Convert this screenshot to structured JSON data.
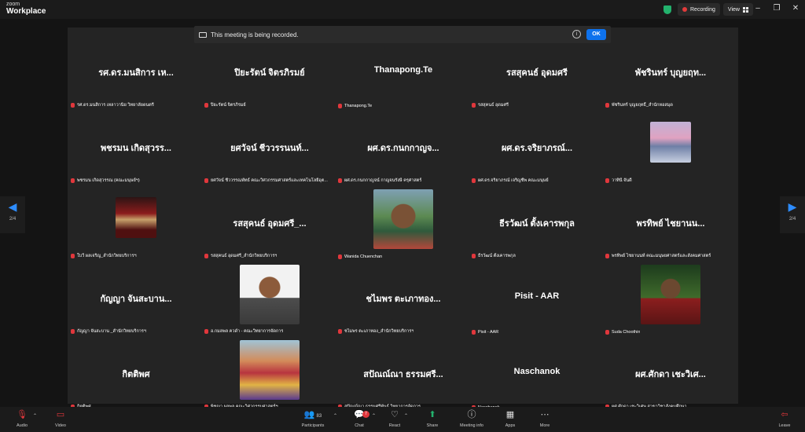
{
  "brand": {
    "top": "zoom",
    "bottom": "Workplace"
  },
  "recording": {
    "label": "Recording"
  },
  "view": {
    "label": "View"
  },
  "window_controls": {
    "minimize": "–",
    "restore": "❐",
    "close": "✕"
  },
  "notice": {
    "text": "This meeting is being recorded.",
    "info": "i",
    "ok": "OK"
  },
  "pager": {
    "left_arrow": "◀",
    "right_arrow": "▶",
    "left_page": "2/4",
    "right_page": "2/4"
  },
  "tiles": [
    {
      "name": "รศ.ดร.มนสิการ เห...",
      "label": "รศ.ดร.มนสิการ เหลาวานิย วิทยาลัยดนตรี"
    },
    {
      "name": "ปิยะรัตน์ จิตรภิรมย์",
      "label": "ปิยะรัตน์ จิตรภิรมย์"
    },
    {
      "name": "Thanapong.Te",
      "label": "Thanapong.Te"
    },
    {
      "name": "รสสุคนธ์ อุดมศรี",
      "label": "รสสุคนธ์ อุดมศรี"
    },
    {
      "name": "พัชรินทร์ บุญยฤท...",
      "label": "พัชรินทร์ บุญยฤทธิ์_สำนักหอสมุด"
    },
    {
      "name": "พชรมน เกิดสุวรร...",
      "label": "พชรมน เกิดสุวรรณ (คณะมนุษย์ฯ)"
    },
    {
      "name": "ยศวัจน์ ชีววรรนนท์...",
      "label": "ยศวัจน์ ชีววรรณพัทธ์ คณะวิศวกรรมศาสตร์และเทคโนโลยีอุต..."
    },
    {
      "name": "ผศ.ดร.กนกกาญจ...",
      "label": "ผศ.ดร.กนกกาญจน์ กาญจนรังษี ครุศาสตร์"
    },
    {
      "name": "ผศ.ดร.จริยาภรณ์...",
      "label": "ผศ.ดร.จริยาภรณ์ เจริญชีพ คณะมนุษย์"
    },
    {
      "name": "",
      "label": "วาทินี จันดี",
      "photo": "p-dusk"
    },
    {
      "name": "",
      "label": "ใบวี ผลเจริญ_สำนักวิทยบริการฯ",
      "photo": "p-temple"
    },
    {
      "name": "รสสุคนธ์ อุดมศรี_...",
      "label": "รสสุคนธ์ อุดมศรี_สำนักวิทยบริการฯ"
    },
    {
      "name": "",
      "label": "Wanida Chuenchan",
      "photo": "p-woman"
    },
    {
      "name": "ธีรวัฒน์ ตั้งเคารพกุล",
      "label": "ธีรวัฒน์ ตั้งเคารพกุล"
    },
    {
      "name": "พรทิพย์ ไชยานน...",
      "label": "พรทิพย์ ไชยานนท์ คณะมนุษยศาสตร์และสังคมศาสตร์"
    },
    {
      "name": "กัญญา จันสะบาน...",
      "label": "กัญญา จันสะบาน _สำนักวิทยบริการฯ"
    },
    {
      "name": "",
      "label": "อ.กมลพล ควดำ - คณะวิทยาการจัดการ",
      "photo": "p-man"
    },
    {
      "name": "ชไมพร ตะเภาทอง...",
      "label": "ชไมพร ตะเภาทอง_สำนักวิทยบริการฯ"
    },
    {
      "name": "Pisit - AAR",
      "label": "Pisit - AAR"
    },
    {
      "name": "",
      "label": "Suda Choothin",
      "photo": "p-suda"
    },
    {
      "name": "กิตติพศ",
      "label": "กิตติพศ"
    },
    {
      "name": "",
      "label": "พิชญา ผลพูล คณะวิศวกรรมศาสตร์ฯ",
      "photo": "p-festival"
    },
    {
      "name": "สปัณณ์ณา ธรรมศรี...",
      "label": "สปัณณ์ณา ธรรมศรีพันธ์ วิทยาการจัดการ"
    },
    {
      "name": "Naschanok",
      "label": "Naschanok"
    },
    {
      "name": "ผศ.ศักดา เชะวิเศ...",
      "label": "ผศ.ศักดา เชะวิเศษ สาขาวิชาสังคมศึกษา"
    }
  ],
  "toolbar": {
    "audio": "Audio",
    "video": "Video",
    "participants": "Participants",
    "participants_count": "83",
    "chat": "Chat",
    "chat_badge": "7",
    "react": "React",
    "share": "Share",
    "meeting_info": "Meeting info",
    "apps": "Apps",
    "more": "More",
    "leave": "Leave"
  }
}
